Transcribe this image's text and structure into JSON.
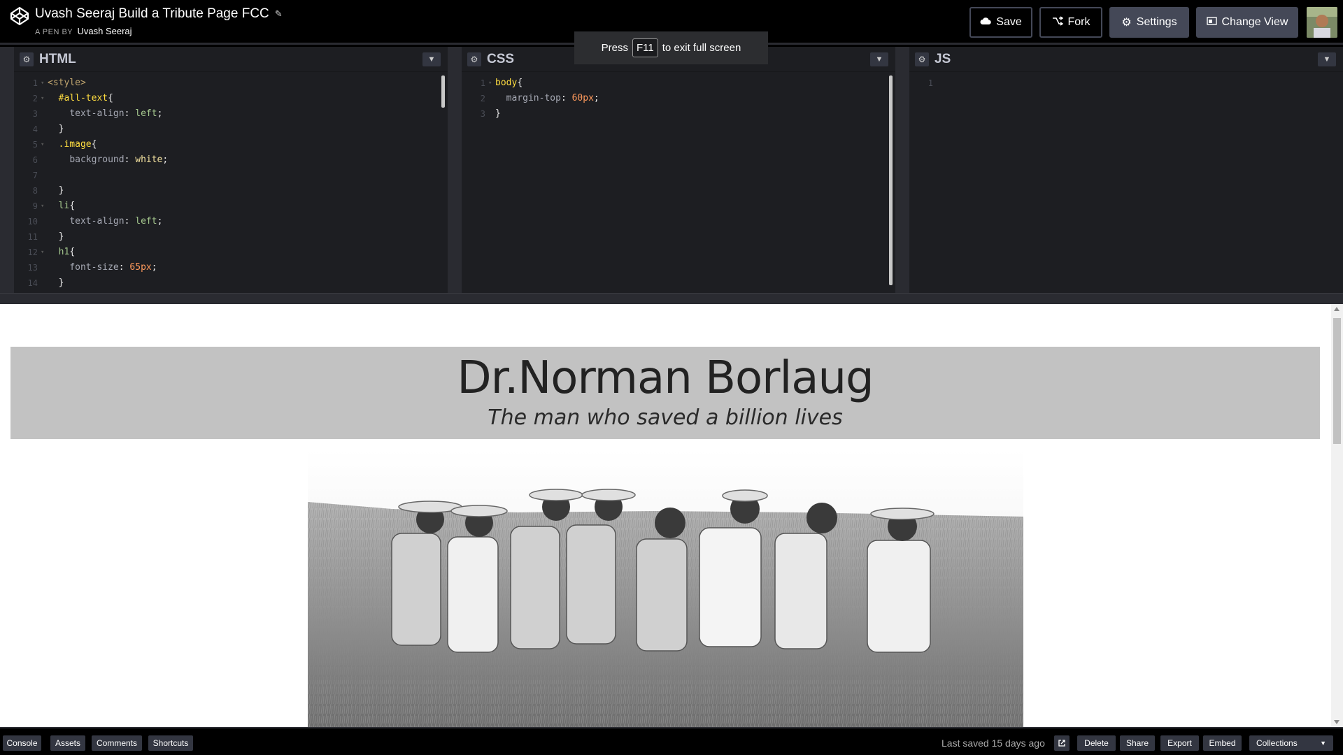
{
  "header": {
    "title": "Uvash Seeraj Build a Tribute Page FCC",
    "by_label": "A PEN BY",
    "author": "Uvash Seeraj",
    "buttons": {
      "save": "Save",
      "fork": "Fork",
      "settings": "Settings",
      "change_view": "Change View"
    }
  },
  "notice": {
    "prefix": "Press",
    "key": "F11",
    "suffix": "to exit full screen"
  },
  "editors": {
    "html": {
      "name": "HTML",
      "lines": [
        {
          "n": "1",
          "fold": "▾",
          "parts": [
            [
              "tag",
              "<style>"
            ]
          ]
        },
        {
          "n": "2",
          "fold": "▾",
          "parts": [
            [
              "plain",
              "  "
            ],
            [
              "sel",
              "#all-text"
            ],
            [
              "punc",
              "{"
            ]
          ]
        },
        {
          "n": "3",
          "fold": "",
          "parts": [
            [
              "plain",
              "    "
            ],
            [
              "prop",
              "text-align"
            ],
            [
              "punc",
              ": "
            ],
            [
              "kw",
              "left"
            ],
            [
              "punc",
              ";"
            ]
          ]
        },
        {
          "n": "4",
          "fold": "",
          "parts": [
            [
              "plain",
              "  "
            ],
            [
              "punc",
              "}"
            ]
          ]
        },
        {
          "n": "5",
          "fold": "▾",
          "parts": [
            [
              "plain",
              "  "
            ],
            [
              "sel",
              ".image"
            ],
            [
              "punc",
              "{"
            ]
          ]
        },
        {
          "n": "6",
          "fold": "",
          "parts": [
            [
              "plain",
              "    "
            ],
            [
              "prop",
              "background"
            ],
            [
              "punc",
              ": "
            ],
            [
              "white",
              "white"
            ],
            [
              "punc",
              ";"
            ]
          ]
        },
        {
          "n": "7",
          "fold": "",
          "parts": [
            [
              "plain",
              ""
            ]
          ]
        },
        {
          "n": "8",
          "fold": "",
          "parts": [
            [
              "plain",
              "  "
            ],
            [
              "punc",
              "}"
            ]
          ]
        },
        {
          "n": "9",
          "fold": "▾",
          "parts": [
            [
              "plain",
              "  "
            ],
            [
              "kw",
              "li"
            ],
            [
              "punc",
              "{"
            ]
          ]
        },
        {
          "n": "10",
          "fold": "",
          "parts": [
            [
              "plain",
              "    "
            ],
            [
              "prop",
              "text-align"
            ],
            [
              "punc",
              ": "
            ],
            [
              "kw",
              "left"
            ],
            [
              "punc",
              ";"
            ]
          ]
        },
        {
          "n": "11",
          "fold": "",
          "parts": [
            [
              "plain",
              "  "
            ],
            [
              "punc",
              "}"
            ]
          ]
        },
        {
          "n": "12",
          "fold": "▾",
          "parts": [
            [
              "plain",
              "  "
            ],
            [
              "kw",
              "h1"
            ],
            [
              "punc",
              "{"
            ]
          ]
        },
        {
          "n": "13",
          "fold": "",
          "parts": [
            [
              "plain",
              "    "
            ],
            [
              "prop",
              "font-size"
            ],
            [
              "punc",
              ": "
            ],
            [
              "num",
              "65px"
            ],
            [
              "punc",
              ";"
            ]
          ]
        },
        {
          "n": "14",
          "fold": "",
          "parts": [
            [
              "plain",
              "  "
            ],
            [
              "punc",
              "}"
            ]
          ]
        }
      ]
    },
    "css": {
      "name": "CSS",
      "lines": [
        {
          "n": "1",
          "fold": "▾",
          "parts": [
            [
              "sel",
              "body"
            ],
            [
              "punc",
              "{"
            ]
          ]
        },
        {
          "n": "2",
          "fold": "",
          "parts": [
            [
              "plain",
              "  "
            ],
            [
              "prop",
              "margin-top"
            ],
            [
              "punc",
              ": "
            ],
            [
              "num",
              "60px"
            ],
            [
              "punc",
              ";"
            ]
          ]
        },
        {
          "n": "3",
          "fold": "",
          "parts": [
            [
              "punc",
              "}"
            ]
          ]
        }
      ]
    },
    "js": {
      "name": "JS",
      "lines": [
        {
          "n": "1",
          "fold": "",
          "parts": [
            [
              "plain",
              ""
            ]
          ]
        }
      ]
    }
  },
  "preview": {
    "heading": "Dr.Norman Borlaug",
    "subheading": "The man who saved a billion lives"
  },
  "footer": {
    "left_buttons": [
      "Console",
      "Assets",
      "Comments",
      "Shortcuts"
    ],
    "last_saved": "Last saved 15 days ago",
    "right_buttons": [
      "Delete",
      "Share",
      "Export",
      "Embed"
    ],
    "collections": "Collections"
  },
  "colors": {
    "accent": "#444857",
    "editor_bg": "#1d1e22",
    "banner_bg": "#c2c2c2"
  }
}
